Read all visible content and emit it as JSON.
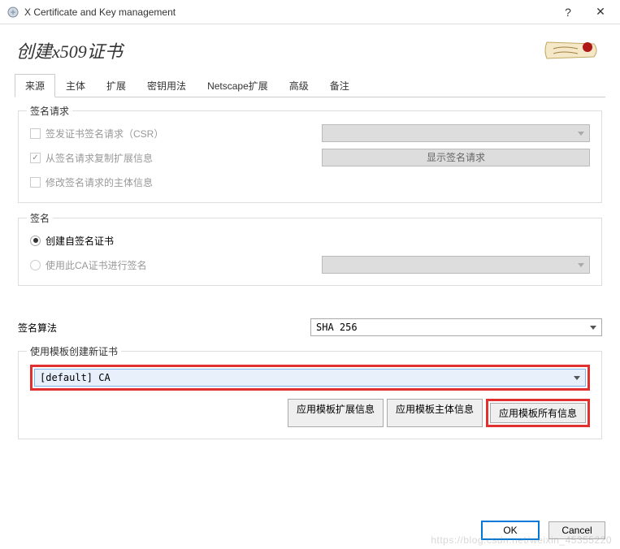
{
  "window": {
    "title": "X Certificate and Key management"
  },
  "header": {
    "title": "创建x509证书"
  },
  "tabs": {
    "items": [
      {
        "label": "来源"
      },
      {
        "label": "主体"
      },
      {
        "label": "扩展"
      },
      {
        "label": "密钥用法"
      },
      {
        "label": "Netscape扩展"
      },
      {
        "label": "高级"
      },
      {
        "label": "备注"
      }
    ]
  },
  "signing_request": {
    "title": "签名请求",
    "issue_csr": "签发证书签名请求（CSR）",
    "copy_ext": "从签名请求复制扩展信息",
    "modify_subject": "修改签名请求的主体信息",
    "show_request_btn": "显示签名请求"
  },
  "signing": {
    "title": "签名",
    "self_signed": "创建自签名证书",
    "use_ca": "使用此CA证书进行签名"
  },
  "algo": {
    "label": "签名算法",
    "value": "SHA 256"
  },
  "template": {
    "title": "使用模板创建新证书",
    "value": "[default] CA",
    "apply_ext": "应用模板扩展信息",
    "apply_subject": "应用模板主体信息",
    "apply_all": "应用模板所有信息"
  },
  "footer": {
    "ok": "OK",
    "cancel": "Cancel"
  },
  "watermark": "https://blog.csdn.net/weixin_45355220"
}
